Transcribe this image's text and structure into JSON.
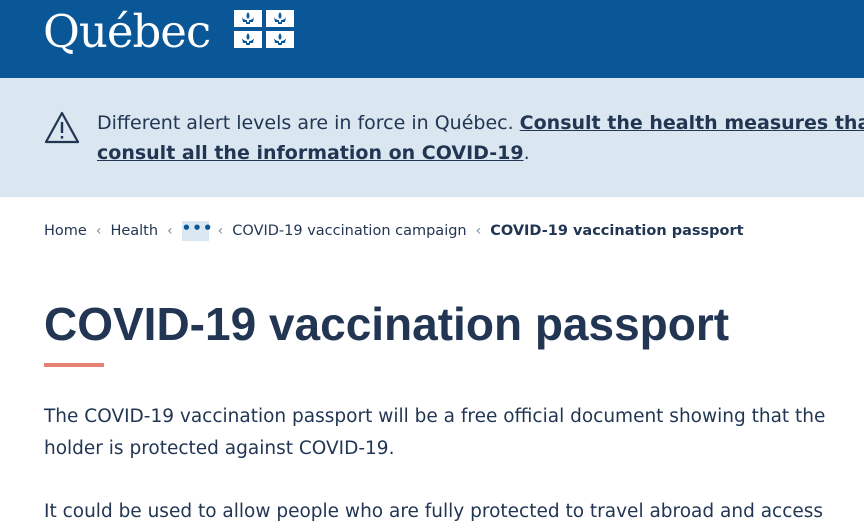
{
  "header": {
    "logo_text": "Québec",
    "logo_flag_icon": "fleur-de-lis-flag-icon",
    "background": "#095797"
  },
  "alert": {
    "icon": "warning-triangle-icon",
    "text": "Different alert levels are in force in Québec. ",
    "link_line1": "Consult the health measures that",
    "link_line2": "consult all the information on COVID-19",
    "trailing": ".",
    "background": "#dae6f0"
  },
  "breadcrumb": {
    "items": [
      "Home",
      "Health",
      "•••",
      "COVID-19 vaccination campaign"
    ],
    "current": "COVID-19 vaccination passport",
    "separator": "‹"
  },
  "page": {
    "title": "COVID-19 vaccination passport",
    "accent_color": "#e58271",
    "paragraph1": "The COVID-19 vaccination passport will be a free official document showing that the holder is protected against COVID-19.",
    "paragraph2": "It could be used to allow people who are fully protected to travel abroad and access"
  }
}
